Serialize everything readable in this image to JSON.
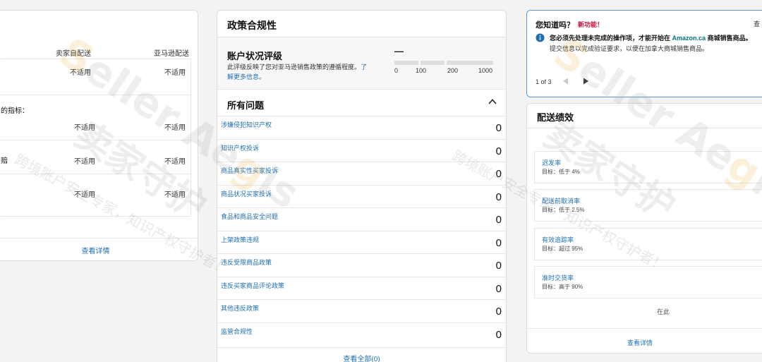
{
  "left_card": {
    "col_self": "卖家自配送",
    "col_amazon": "亚马逊配送",
    "na": "不适用",
    "metrics_label": "的指标：",
    "row_fragment": "赔",
    "view_details": "查看详情"
  },
  "policy_card": {
    "title": "政策合规性",
    "rating_title": "账户状况评级",
    "rating_desc": "此评级反映了您对亚马逊销售政策的遵循程度。",
    "rating_link": "了解更多信息。",
    "rating_value": "—",
    "scale": [
      "0",
      "100",
      "200",
      "1000"
    ],
    "issues_title": "所有问题",
    "issues": [
      {
        "label": "涉嫌侵犯知识产权",
        "count": "0"
      },
      {
        "label": "知识产权投诉",
        "count": "0"
      },
      {
        "label": "商品真实性买家投诉",
        "count": "0"
      },
      {
        "label": "商品状况买家投诉",
        "count": "0"
      },
      {
        "label": "食品和商品安全问题",
        "count": "0"
      },
      {
        "label": "上架政策违规",
        "count": "0"
      },
      {
        "label": "违反受限商品政策",
        "count": "0"
      },
      {
        "label": "违反买家商品评论政策",
        "count": "0"
      },
      {
        "label": "其他违反政策",
        "count": "0"
      },
      {
        "label": "监管合规性",
        "count": "0"
      }
    ],
    "view_all": "查看全部(0)"
  },
  "did_you_know": {
    "title": "您知道吗？",
    "new_badge": "新功能！",
    "text_prefix": "您必须先处理未完成的操作项，才能开始在",
    "text_brand": "Amazon.ca",
    "text_suffix": "商城销售商品。",
    "text_line2": "提交信息以完成验证要求，以便在加拿大商城销售商品。",
    "page": "1 of 3",
    "right_fragment": "查"
  },
  "shipping_card": {
    "title": "配送绩效",
    "metrics": [
      {
        "name": "迟发率",
        "target": "目标：低于 4%"
      },
      {
        "name": "配送前取消率",
        "target": "目标：低于 2.5%"
      },
      {
        "name": "有效追踪率",
        "target": "目标：超过 95%"
      },
      {
        "name": "准时交货率",
        "target": "目标：高于 90%"
      }
    ],
    "more_fragment": "在此",
    "view_details": "查看详情"
  },
  "watermark": {
    "brand_latin": "Seller Aegis",
    "brand_cn": "卖家守护",
    "slogan": "跨境账户安全专家，知识产权守护者！"
  },
  "colors": {
    "link": "#1f6fb2",
    "new_badge": "#cc0c39",
    "info_icon": "#1f6fb2",
    "amazon_link": "#007185"
  }
}
